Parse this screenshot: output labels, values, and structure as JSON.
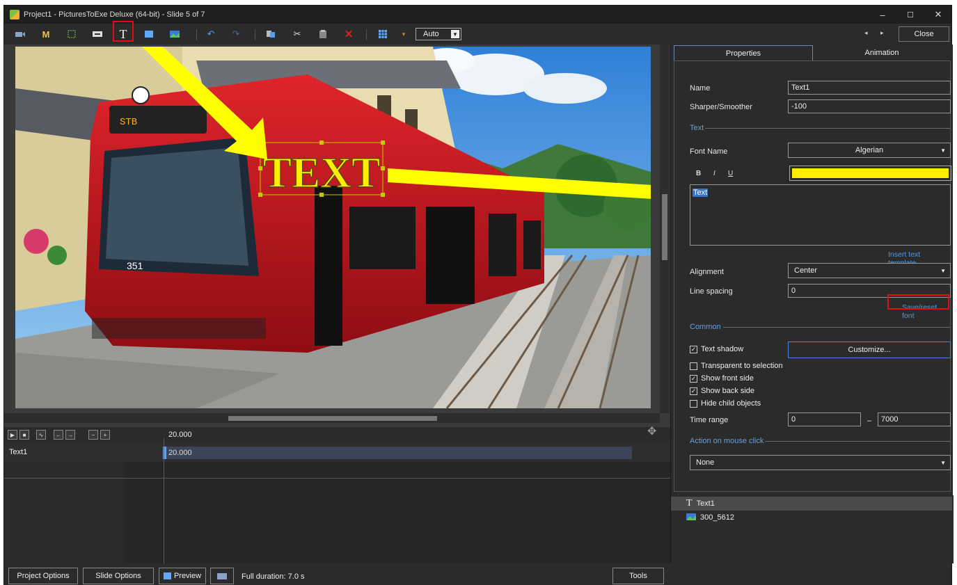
{
  "window": {
    "title": "Project1 - PicturesToExe Deluxe (64-bit) - Slide 5 of 7",
    "minimize": "–",
    "maximize": "☐",
    "close": "✕"
  },
  "toolbar": {
    "m_label": "M",
    "text_tool": "T",
    "auto_label": "Auto",
    "close_label": "Close",
    "prev_label": "◂",
    "next_label": "▸"
  },
  "canvas": {
    "overlay_text": "TEXT"
  },
  "timeline": {
    "time": "20.000",
    "track_name": "Text1",
    "clip_time": "20.000"
  },
  "bottom": {
    "project_options": "Project Options",
    "slide_options": "Slide Options",
    "preview": "Preview",
    "full_duration": "Full duration: 7.0 s",
    "tools": "Tools"
  },
  "panel": {
    "tabs": {
      "properties": "Properties",
      "animation": "Animation"
    },
    "name_label": "Name",
    "name_value": "Text1",
    "sharper_label": "Sharper/Smoother",
    "sharper_value": "-100",
    "text_section": "Text",
    "font_name_label": "Font Name",
    "font_name_value": "Algerian",
    "bold": "B",
    "italic": "I",
    "underline": "U",
    "text_color": "#ffee00",
    "text_value": "Text",
    "insert_template": "Insert text template",
    "alignment_label": "Alignment",
    "alignment_value": "Center",
    "line_spacing_label": "Line spacing",
    "line_spacing_value": "0",
    "save_reset_font": "Save/reset font",
    "common_section": "Common",
    "text_shadow": "Text shadow",
    "customize": "Customize...",
    "transparent": "Transparent to selection",
    "show_front": "Show front side",
    "show_back": "Show back side",
    "hide_child": "Hide child objects",
    "time_range_label": "Time range",
    "time_range_from": "0",
    "time_range_dash": "–",
    "time_range_to": "7000",
    "mouse_section": "Action on mouse click",
    "mouse_action": "None",
    "checks": {
      "text_shadow": true,
      "transparent": false,
      "show_front": true,
      "show_back": true,
      "hide_child": false
    }
  },
  "objects": [
    {
      "name": "Text1",
      "icon": "text-icon"
    },
    {
      "name": "300_5612",
      "icon": "image-icon"
    }
  ],
  "colors": {
    "accent": "#6a9fd8",
    "link": "#4f9be8",
    "highlight": "#e01010",
    "arrow": "#ffff00",
    "tram": "#c8161d"
  }
}
